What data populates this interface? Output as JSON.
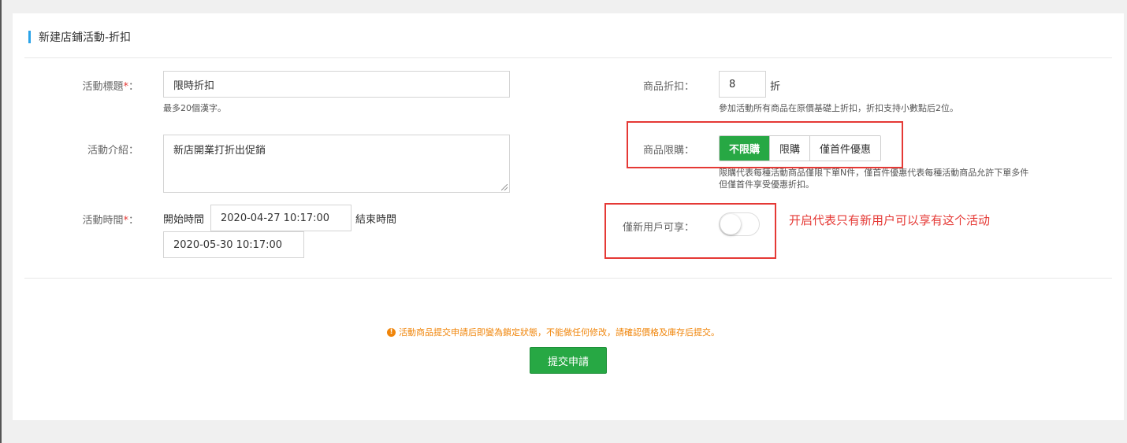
{
  "page": {
    "title": "新建店鋪活動-折扣"
  },
  "form": {
    "activity_title": {
      "label": "活動標題",
      "required_mark": "*",
      "colon": "：",
      "value": "限時折扣",
      "hint": "最多20個漢字。"
    },
    "activity_intro": {
      "label": "活動介紹",
      "colon": "：",
      "value": "新店開業打折出促銷"
    },
    "activity_time": {
      "label": "活動時間",
      "required_mark": "*",
      "colon": "：",
      "start_label": "開始時間",
      "start_value": "2020-04-27 10:17:00",
      "end_label": "結束時間",
      "end_value": "2020-05-30 10:17:00"
    },
    "discount": {
      "label": "商品折扣：",
      "value": "8",
      "unit": "折",
      "hint": "參加活動所有商品在原價基礎上折扣，折扣支持小數點后2位。"
    },
    "purchase_limit": {
      "label": "商品限購：",
      "options": [
        "不限購",
        "限購",
        "僅首件優惠"
      ],
      "selected": "不限購",
      "hint_line1": "限購代表每種活動商品僅限下單N件，僅首件優惠代表每種活動商品允許下單多件",
      "hint_line2": "但僅首件享受優惠折扣。"
    },
    "new_users_only": {
      "label": "僅新用戶可享：",
      "enabled": false
    }
  },
  "annotation": {
    "note": "开启代表只有新用户可以享有这个活动",
    "color": "#e53935"
  },
  "footer": {
    "warning_icon": "exclamation-circle-icon",
    "warning_text": "活動商品提交申請后即變為鎖定狀態，不能做任何修改，請確認價格及庫存后提交。",
    "submit_label": "提交申請"
  },
  "colors": {
    "accent": "#2aa3e8",
    "primary_green": "#27a844",
    "warning": "#f0850a"
  }
}
